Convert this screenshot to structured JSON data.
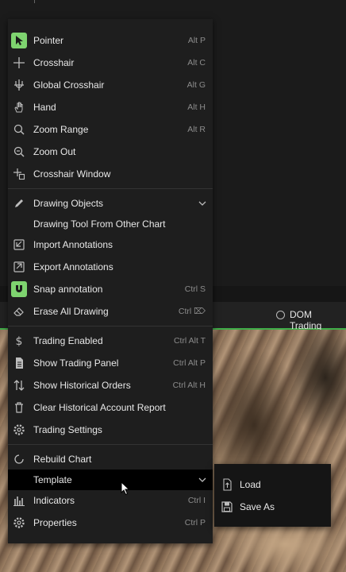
{
  "colors": {
    "accent_green": "#7ed36f",
    "menu_bg": "#1e1e1e",
    "highlight_bg": "#000000",
    "underline_green": "#3fae49"
  },
  "toolbar": {
    "dom_trading_label": "DOM Trading"
  },
  "menu": {
    "group1": [
      {
        "label": "Pointer",
        "shortcut": "Alt P",
        "icon": "pointer-icon",
        "active": true
      },
      {
        "label": "Crosshair",
        "shortcut": "Alt C",
        "icon": "crosshair-icon"
      },
      {
        "label": "Global Crosshair",
        "shortcut": "Alt G",
        "icon": "global-crosshair-icon"
      },
      {
        "label": "Hand",
        "shortcut": "Alt H",
        "icon": "hand-icon"
      },
      {
        "label": "Zoom Range",
        "shortcut": "Alt R",
        "icon": "zoom-range-icon"
      },
      {
        "label": "Zoom Out",
        "shortcut": "",
        "icon": "zoom-out-icon"
      },
      {
        "label": "Crosshair Window",
        "shortcut": "",
        "icon": "crosshair-window-icon"
      }
    ],
    "group2": [
      {
        "label": "Drawing Objects",
        "shortcut": "",
        "icon": "pencil-icon",
        "submenu": true
      },
      {
        "label": "Drawing Tool From Other Chart",
        "shortcut": "",
        "icon": ""
      },
      {
        "label": "Import Annotations",
        "shortcut": "",
        "icon": "import-icon"
      },
      {
        "label": "Export Annotations",
        "shortcut": "",
        "icon": "export-icon"
      },
      {
        "label": "Snap annotation",
        "shortcut": "Ctrl S",
        "icon": "magnet-icon",
        "active": true
      },
      {
        "label": "Erase All Drawing",
        "shortcut": "Ctrl ⌦",
        "icon": "eraser-icon"
      }
    ],
    "group3": [
      {
        "label": "Trading Enabled",
        "shortcut": "Ctrl Alt T",
        "icon": "dollar-icon"
      },
      {
        "label": "Show Trading Panel",
        "shortcut": "Ctrl Alt P",
        "icon": "document-icon"
      },
      {
        "label": "Show Historical Orders",
        "shortcut": "Ctrl Alt H",
        "icon": "arrows-updown-icon"
      },
      {
        "label": "Clear Historical Account Report",
        "shortcut": "",
        "icon": "trash-icon"
      },
      {
        "label": "Trading Settings",
        "shortcut": "",
        "icon": "gear-icon"
      }
    ],
    "group4": [
      {
        "label": "Rebuild Chart",
        "shortcut": "",
        "icon": "refresh-icon"
      },
      {
        "label": "Template",
        "shortcut": "",
        "icon": "",
        "submenu": true,
        "highlighted": true
      },
      {
        "label": "Indicators",
        "shortcut": "Ctrl I",
        "icon": "indicators-icon"
      },
      {
        "label": "Properties",
        "shortcut": "Ctrl P",
        "icon": "gear-icon"
      }
    ]
  },
  "template_submenu": [
    {
      "label": "Load",
      "icon": "load-file-icon"
    },
    {
      "label": "Save As",
      "icon": "save-icon"
    }
  ]
}
